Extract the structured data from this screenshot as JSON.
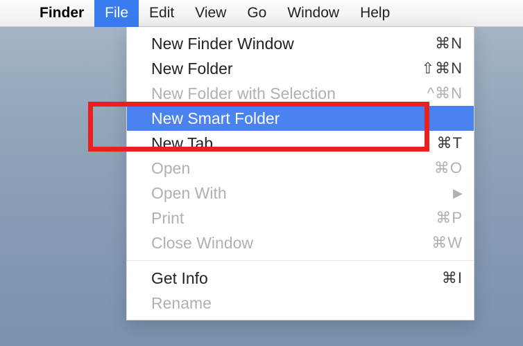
{
  "menubar": {
    "app": "Finder",
    "items": [
      {
        "label": "File",
        "active": true
      },
      {
        "label": "Edit",
        "active": false
      },
      {
        "label": "View",
        "active": false
      },
      {
        "label": "Go",
        "active": false
      },
      {
        "label": "Window",
        "active": false
      },
      {
        "label": "Help",
        "active": false
      }
    ]
  },
  "dropdown": {
    "items": [
      {
        "label": "New Finder Window",
        "shortcut": "⌘N",
        "enabled": true,
        "highlight": false
      },
      {
        "label": "New Folder",
        "shortcut": "⇧⌘N",
        "enabled": true,
        "highlight": false
      },
      {
        "label": "New Folder with Selection",
        "shortcut": "^⌘N",
        "enabled": false,
        "highlight": false
      },
      {
        "label": "New Smart Folder",
        "shortcut": "",
        "enabled": true,
        "highlight": true
      },
      {
        "label": "New Tab",
        "shortcut": "⌘T",
        "enabled": true,
        "highlight": false
      },
      {
        "label": "Open",
        "shortcut": "⌘O",
        "enabled": false,
        "highlight": false
      },
      {
        "label": "Open With",
        "shortcut": "",
        "submenu": true,
        "enabled": false,
        "highlight": false
      },
      {
        "label": "Print",
        "shortcut": "⌘P",
        "enabled": false,
        "highlight": false
      },
      {
        "label": "Close Window",
        "shortcut": "⌘W",
        "enabled": false,
        "highlight": false
      },
      {
        "separator": true
      },
      {
        "label": "Get Info",
        "shortcut": "⌘I",
        "enabled": true,
        "highlight": false
      },
      {
        "label": "Rename",
        "shortcut": "",
        "enabled": false,
        "highlight": false
      }
    ]
  }
}
